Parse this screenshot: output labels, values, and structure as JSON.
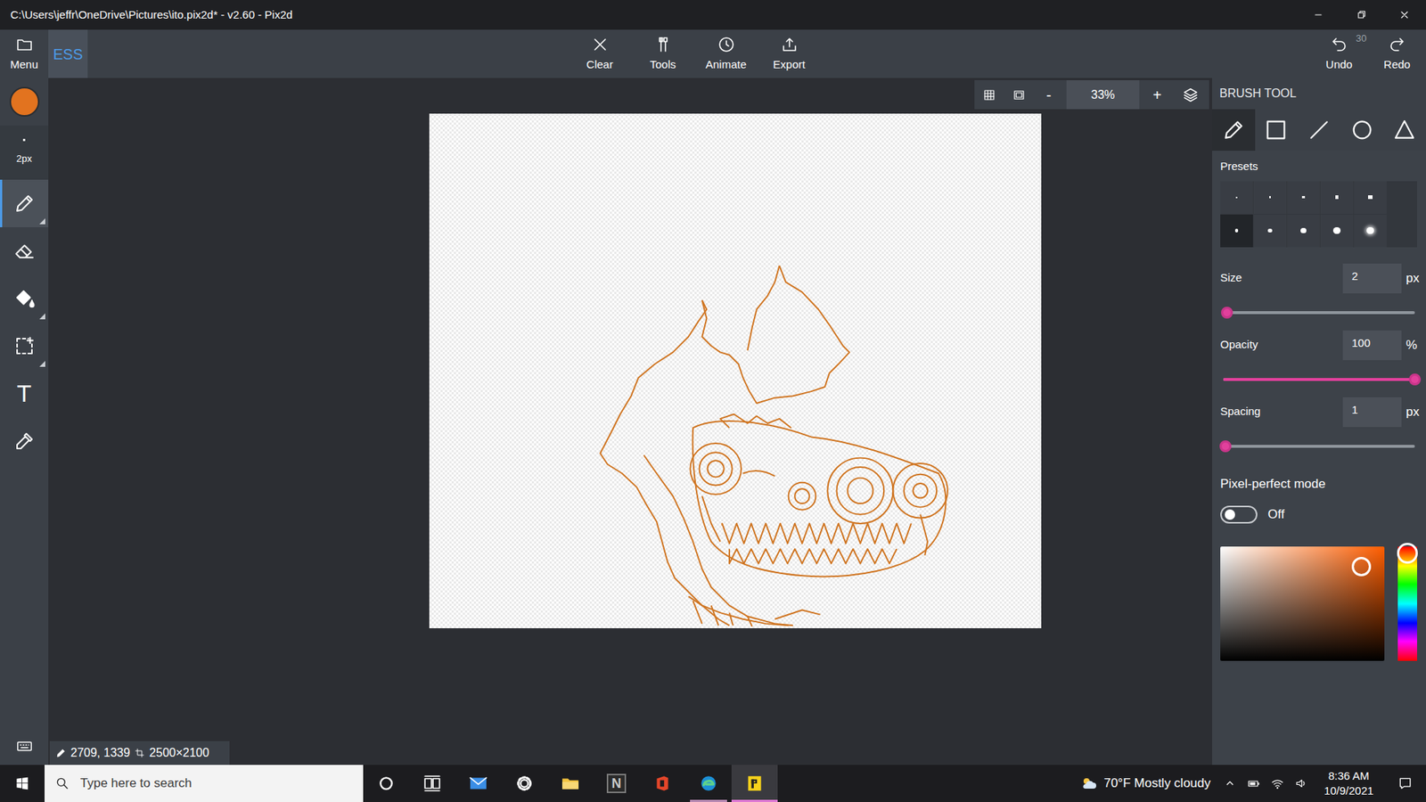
{
  "window": {
    "title": "C:\\Users\\jeffr\\OneDrive\\Pictures\\ito.pix2d* - v2.60 - Pix2d",
    "controls": [
      {
        "kind": "minimize"
      },
      {
        "kind": "restore"
      },
      {
        "kind": "close"
      }
    ]
  },
  "toolbar": {
    "menu": "Menu",
    "project": "ESS",
    "actions": [
      {
        "label": "Clear",
        "kind": "clear"
      },
      {
        "label": "Tools",
        "kind": "tools"
      },
      {
        "label": "Animate",
        "kind": "animate"
      },
      {
        "label": "Export",
        "kind": "export"
      }
    ],
    "undo": {
      "label": "Undo",
      "count": "30"
    },
    "redo": {
      "label": "Redo"
    }
  },
  "sidebar": {
    "color": "#e2731f",
    "brush_size": "2px",
    "tools": [
      {
        "kind": "pencil",
        "selected": true,
        "submenu": true
      },
      {
        "kind": "eraser",
        "selected": false,
        "submenu": false
      },
      {
        "kind": "fill",
        "selected": false,
        "submenu": true
      },
      {
        "kind": "select",
        "selected": false,
        "submenu": true
      },
      {
        "kind": "text",
        "label": "T",
        "selected": false,
        "submenu": false
      },
      {
        "kind": "picker",
        "selected": false,
        "submenu": false
      }
    ]
  },
  "zoom": {
    "out": "-",
    "value": "33%",
    "in": "+"
  },
  "status_bar": {
    "cursor": "2709, 1339",
    "size": "2500×2100"
  },
  "brush_panel": {
    "title": "BRUSH TOOL",
    "shapes": [
      {
        "kind": "pencil",
        "selected": true
      },
      {
        "kind": "rectangle",
        "selected": false
      },
      {
        "kind": "line",
        "selected": false
      },
      {
        "kind": "ellipse",
        "selected": false
      },
      {
        "kind": "triangle",
        "selected": false
      }
    ],
    "presets_label": "Presets",
    "presets": [
      {
        "kind": "square",
        "level": 0.0,
        "selected": false
      },
      {
        "kind": "square",
        "level": 0.05,
        "selected": false
      },
      {
        "kind": "square",
        "level": 0.12,
        "selected": false
      },
      {
        "kind": "square",
        "level": 0.18,
        "selected": false
      },
      {
        "kind": "square",
        "level": 0.22,
        "selected": false
      },
      {
        "kind": "round",
        "level": 0.15,
        "selected": true
      },
      {
        "kind": "round",
        "level": 0.28,
        "selected": false
      },
      {
        "kind": "round",
        "level": 0.4,
        "selected": false
      },
      {
        "kind": "round",
        "level": 0.52,
        "selected": false
      },
      {
        "kind": "soft",
        "level": 0.55,
        "selected": false
      }
    ],
    "sliders": [
      {
        "label": "Size",
        "value": "2",
        "unit": "px",
        "level": 0.02
      },
      {
        "label": "Opacity",
        "value": "100",
        "unit": "%",
        "level": 1.0
      },
      {
        "label": "Spacing",
        "value": "1",
        "unit": "px",
        "level": 0.01
      }
    ],
    "pixel_perfect": {
      "label": "Pixel-perfect mode",
      "on": false,
      "state": "Off"
    },
    "color_picker": {
      "hue_level": 0.06,
      "saturation": 0.86,
      "brightness": 0.82
    }
  },
  "taskbar": {
    "search": "Type here to search",
    "apps": [
      {
        "kind": "cortana",
        "running": false,
        "selected": false
      },
      {
        "kind": "taskview",
        "running": false,
        "selected": false
      },
      {
        "kind": "mail",
        "running": false,
        "selected": false
      },
      {
        "kind": "settings",
        "running": false,
        "selected": false
      },
      {
        "kind": "explorer",
        "running": false,
        "selected": false
      },
      {
        "kind": "notion",
        "label": "N",
        "running": false,
        "selected": false
      },
      {
        "kind": "office",
        "running": false,
        "selected": false
      },
      {
        "kind": "edge",
        "running": true,
        "selected": false
      },
      {
        "kind": "pix2d",
        "running": true,
        "selected": true
      }
    ],
    "weather": "70°F  Mostly cloudy",
    "tray": [
      {
        "kind": "chevron"
      },
      {
        "kind": "battery"
      },
      {
        "kind": "wifi"
      },
      {
        "kind": "volume"
      }
    ],
    "time": "8:36 AM",
    "date": "10/9/2021"
  }
}
